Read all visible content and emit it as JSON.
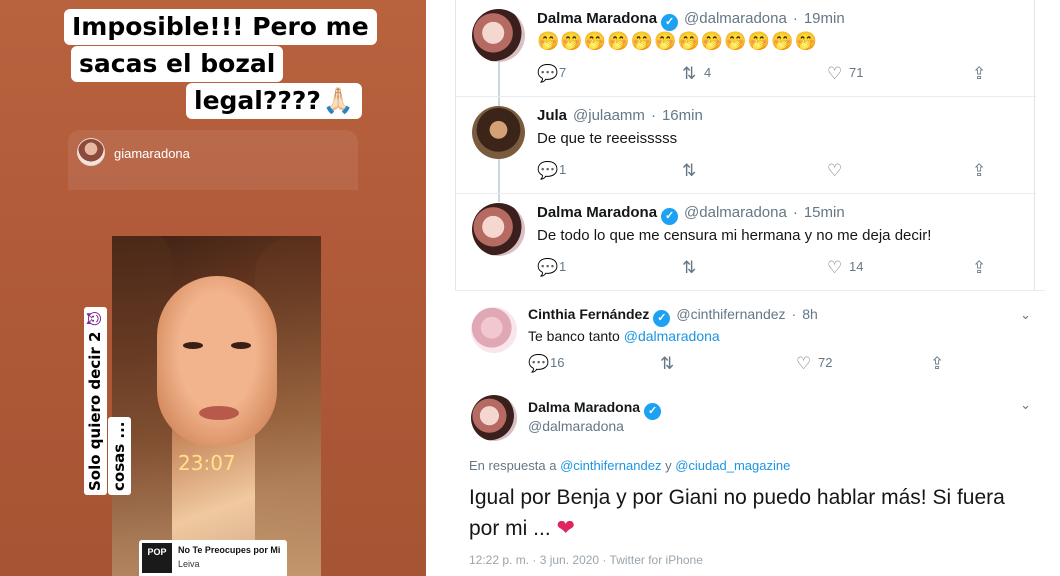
{
  "story": {
    "caption": [
      "Imposible!!! Pero me",
      "sacas el bozal",
      "legal????"
    ],
    "caption_emoji": "🙏🏻",
    "shared_username": "giamaradona",
    "time": "23:07",
    "music": {
      "title": "No Te Preocupes por Mi",
      "artist": "Leiva",
      "cover_text": "POP"
    },
    "vertical_text": [
      "Solo quiero decir 2",
      "cosas ..."
    ],
    "vertical_emoji": "😈"
  },
  "thread": {
    "tweets": [
      {
        "name": "Dalma Maradona",
        "verified": true,
        "handle": "@dalmaradona",
        "time": "19min",
        "text": "🤭🤭🤭🤭🤭🤭🤭🤭🤭🤭🤭🤭",
        "replies": "7",
        "retweets": "4",
        "likes": "71"
      },
      {
        "name": "Jula",
        "verified": false,
        "handle": "@julaamm",
        "time": "16min",
        "text": "De que te reeeisssss",
        "replies": "1",
        "retweets": "",
        "likes": ""
      },
      {
        "name": "Dalma Maradona",
        "verified": true,
        "handle": "@dalmaradona",
        "time": "15min",
        "text": "De todo lo que me censura mi hermana y no me deja decir!",
        "replies": "1",
        "retweets": "",
        "likes": "14"
      }
    ]
  },
  "reply": {
    "cinthia": {
      "name": "Cinthia Fernández",
      "handle": "@cinthifernandez",
      "time": "8h",
      "text_prefix": "Te banco tanto",
      "mention": "@dalmaradona",
      "replies": "16",
      "retweets": "",
      "likes": "72"
    },
    "dalma": {
      "name": "Dalma Maradona",
      "handle": "@dalmaradona",
      "in_reply_prefix": "En respuesta a",
      "in_reply_1": "@cinthifernandez",
      "in_reply_join": "y",
      "in_reply_2": "@ciudad_magazine",
      "text": "Igual por Benja y por Giani no puedo hablar más! Si fuera por mi ...",
      "heart": "❤",
      "footer": "12:22 p. m. · 3 jun. 2020 · Twitter for iPhone"
    }
  },
  "icons": {
    "reply": "💬",
    "retweet": "⇅",
    "like": "♡",
    "share": "⇪",
    "chevron": "⌄",
    "check": "✓"
  },
  "colors": {
    "twitter_blue": "#1da1f2",
    "story_bg": "#b05a39",
    "heart": "#e0245e"
  }
}
